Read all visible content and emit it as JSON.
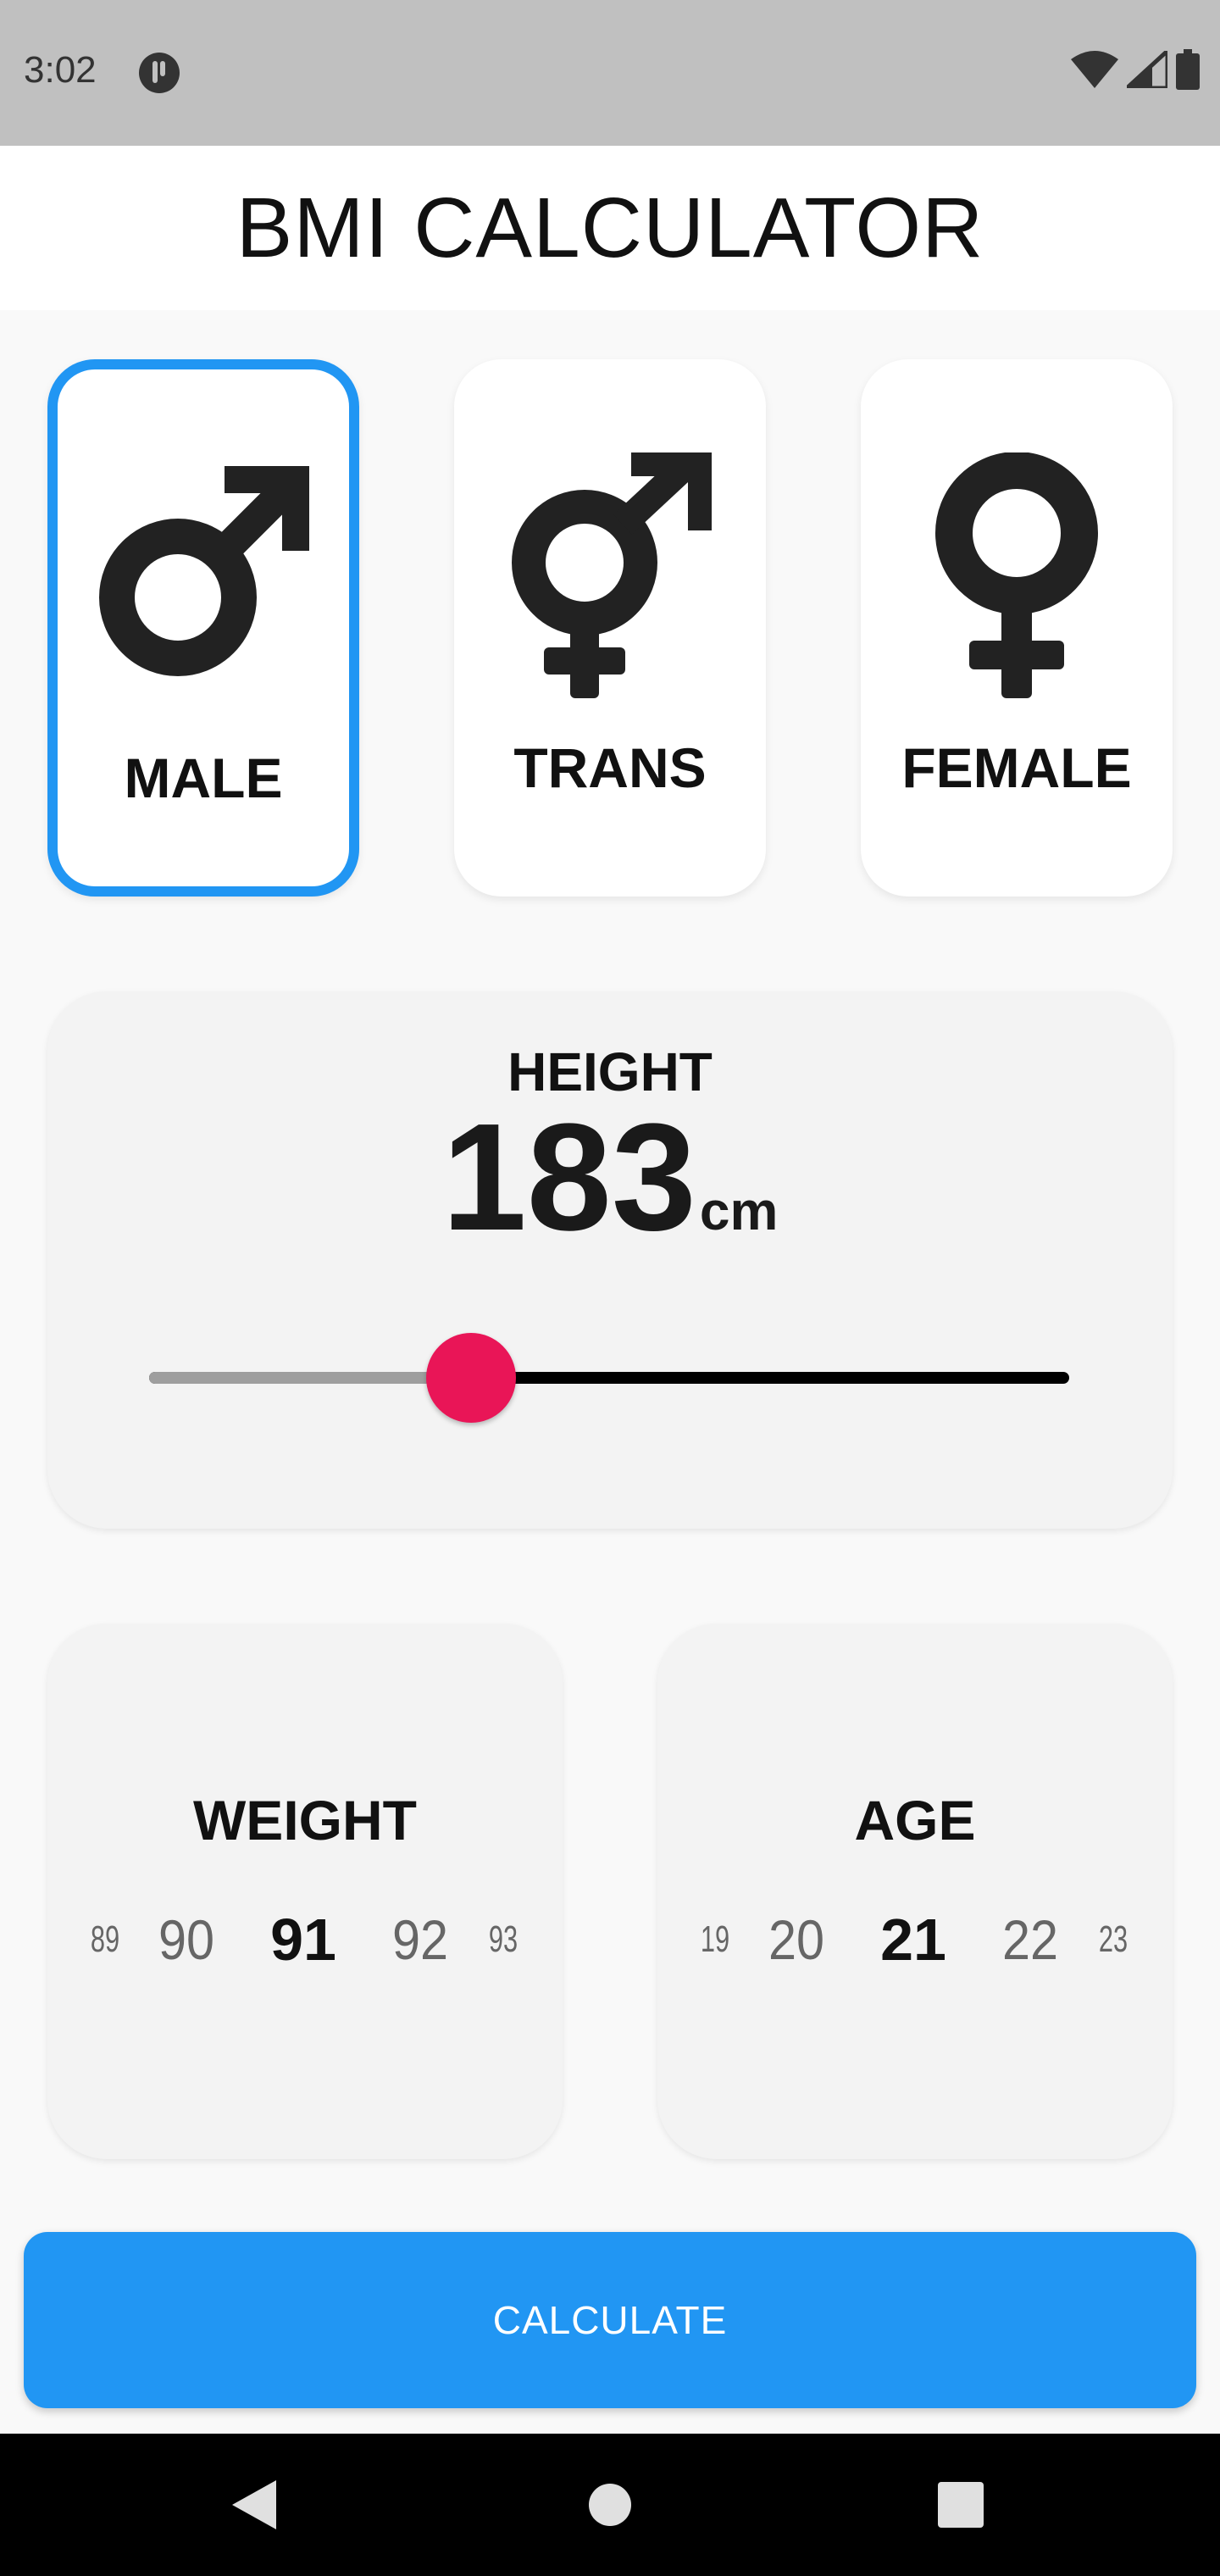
{
  "status_bar": {
    "time": "3:02",
    "icons": [
      "app-notification-icon",
      "wifi-icon",
      "cellular-signal-icon",
      "battery-icon"
    ]
  },
  "app_bar": {
    "title": "BMI CALCULATOR"
  },
  "gender": {
    "options": [
      {
        "label": "MALE",
        "icon": "male-symbol-icon",
        "selected": true
      },
      {
        "label": "TRANS",
        "icon": "transgender-symbol-icon",
        "selected": false
      },
      {
        "label": "FEMALE",
        "icon": "female-symbol-icon",
        "selected": false
      }
    ]
  },
  "height": {
    "label": "HEIGHT",
    "value": "183",
    "unit": "cm",
    "slider_fraction": 0.35
  },
  "weight": {
    "label": "WEIGHT",
    "values": [
      "89",
      "90",
      "91",
      "92",
      "93"
    ],
    "selected": "91"
  },
  "age": {
    "label": "AGE",
    "values": [
      "19",
      "20",
      "21",
      "22",
      "23"
    ],
    "selected": "21"
  },
  "actions": {
    "calculate_label": "CALCULATE"
  },
  "colors": {
    "accent": "#2196f3",
    "slider_thumb": "#e91557",
    "status_bar": "#c0c0c0",
    "nav_bar": "#000000"
  },
  "nav_bar": {
    "buttons": [
      "back-icon",
      "home-icon",
      "recents-icon"
    ]
  }
}
